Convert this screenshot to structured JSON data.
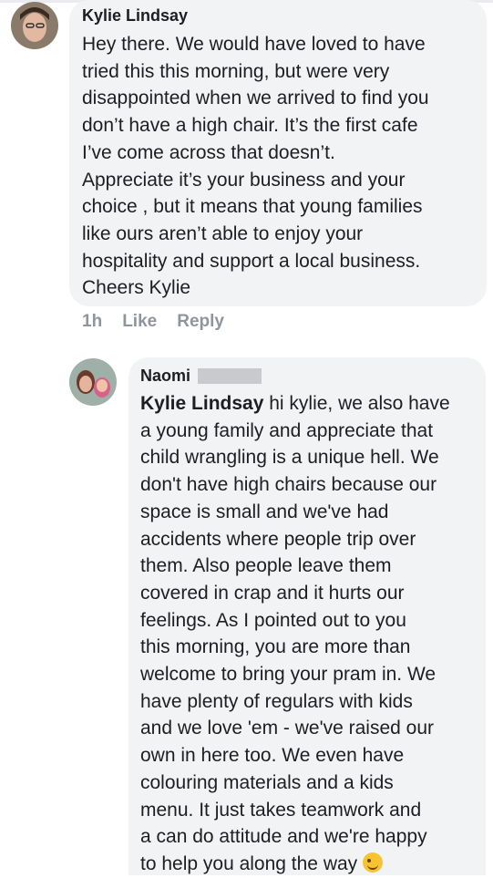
{
  "comments": [
    {
      "author": "Kylie Lindsay",
      "lines": [
        "Hey there. We would have loved to have",
        "tried this this morning, but were very",
        "disappointed when we arrived to find you",
        "don’t have a high chair. It’s the first cafe",
        "I’ve come across that doesn’t.",
        "Appreciate it’s your business and your",
        "choice , but it means that young families",
        "like ours aren’t able to enjoy your",
        "hospitality and support a local business.",
        "Cheers Kylie"
      ],
      "time": "1h",
      "like_label": "Like",
      "reply_label": "Reply"
    },
    {
      "author": "Naomi",
      "mention": "Kylie Lindsay",
      "lines": [
        " hi kylie, we also have",
        "a young family and appreciate that",
        "child wrangling is a unique hell. We",
        "don't have high chairs because our",
        "space is small and we've had",
        "accidents where people trip over",
        "them. Also people leave them",
        "covered in crap and it hurts our",
        "feelings. As I pointed out to you",
        "this morning, you are more than",
        "welcome to bring your pram in. We",
        "have plenty of regulars with kids",
        "and we love 'em - we've raised our",
        "own in here too. We even have",
        "colouring materials and a kids",
        "menu. It just takes teamwork and",
        "a can do attitude and we're happy",
        "to help you along the way"
      ],
      "emoji": "winking-face"
    }
  ]
}
